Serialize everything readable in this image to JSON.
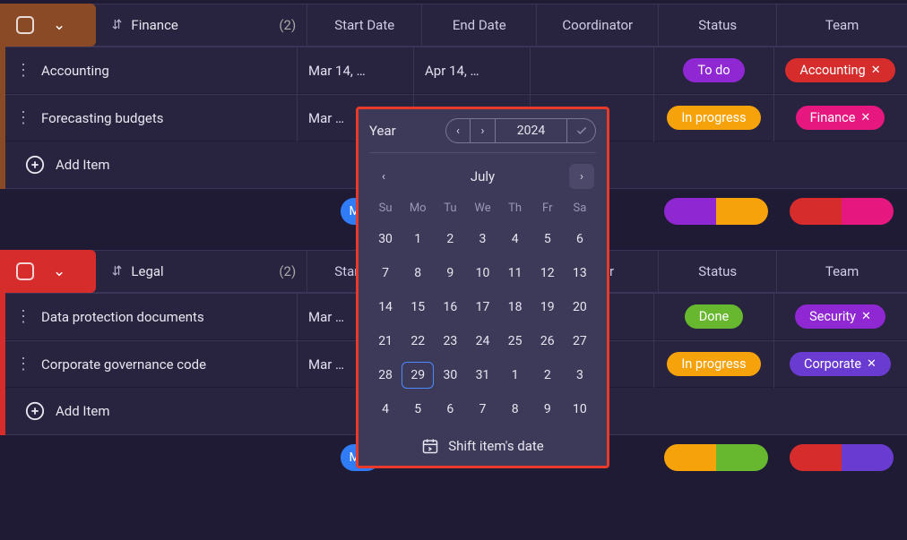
{
  "columns": {
    "start": "Start Date",
    "end": "End Date",
    "coordinator": "Coordinator",
    "status": "Status",
    "team": "Team"
  },
  "groups": [
    {
      "name": "Finance",
      "count": "(2)",
      "accent": "finance",
      "items": [
        {
          "name": "Accounting",
          "start": "Mar 14, …",
          "end": "Apr 14, …",
          "status": "To do",
          "status_class": "badge-todo",
          "team": "Accounting",
          "team_class": "tag-accounting"
        },
        {
          "name": "Forecasting budgets",
          "start": "Mar …",
          "end": "",
          "status": "In progress",
          "status_class": "badge-inprog",
          "team": "Finance",
          "team_class": "tag-finance"
        }
      ],
      "add_label": "Add Item",
      "summary_date": "Mar",
      "status_segments": [
        {
          "color": "#8f27d3",
          "w": 58
        },
        {
          "color": "#f6a20b",
          "w": 58
        }
      ],
      "team_segments": [
        {
          "color": "#d62c2c",
          "w": 58
        },
        {
          "color": "#e6177e",
          "w": 58
        }
      ]
    },
    {
      "name": "Legal",
      "count": "(2)",
      "accent": "legal",
      "items": [
        {
          "name": "Data protection documents",
          "start": "Mar …",
          "end": "",
          "status": "Done",
          "status_class": "badge-done",
          "team": "Security",
          "team_class": "tag-security"
        },
        {
          "name": "Corporate governance code",
          "start": "Mar …",
          "end": "",
          "status": "In progress",
          "status_class": "badge-inprog",
          "team": "Corporate",
          "team_class": "tag-corporate"
        }
      ],
      "add_label": "Add Item",
      "summary_date": "Mar",
      "status_segments": [
        {
          "color": "#f6a20b",
          "w": 58
        },
        {
          "color": "#67b82f",
          "w": 58
        }
      ],
      "team_segments": [
        {
          "color": "#d62c2c",
          "w": 58
        },
        {
          "color": "#6a3bd0",
          "w": 58
        }
      ]
    }
  ],
  "datepicker": {
    "year_label": "Year",
    "year_value": "2024",
    "month": "July",
    "dow": [
      "Su",
      "Mo",
      "Tu",
      "We",
      "Th",
      "Fr",
      "Sa"
    ],
    "weeks": [
      [
        "30",
        "1",
        "2",
        "3",
        "4",
        "5",
        "6"
      ],
      [
        "7",
        "8",
        "9",
        "10",
        "11",
        "12",
        "13"
      ],
      [
        "14",
        "15",
        "16",
        "17",
        "18",
        "19",
        "20"
      ],
      [
        "21",
        "22",
        "23",
        "24",
        "25",
        "26",
        "27"
      ],
      [
        "28",
        "29",
        "30",
        "31",
        "1",
        "2",
        "3"
      ],
      [
        "4",
        "5",
        "6",
        "7",
        "8",
        "9",
        "10"
      ]
    ],
    "selected": "29",
    "shift_label": "Shift item's date"
  }
}
